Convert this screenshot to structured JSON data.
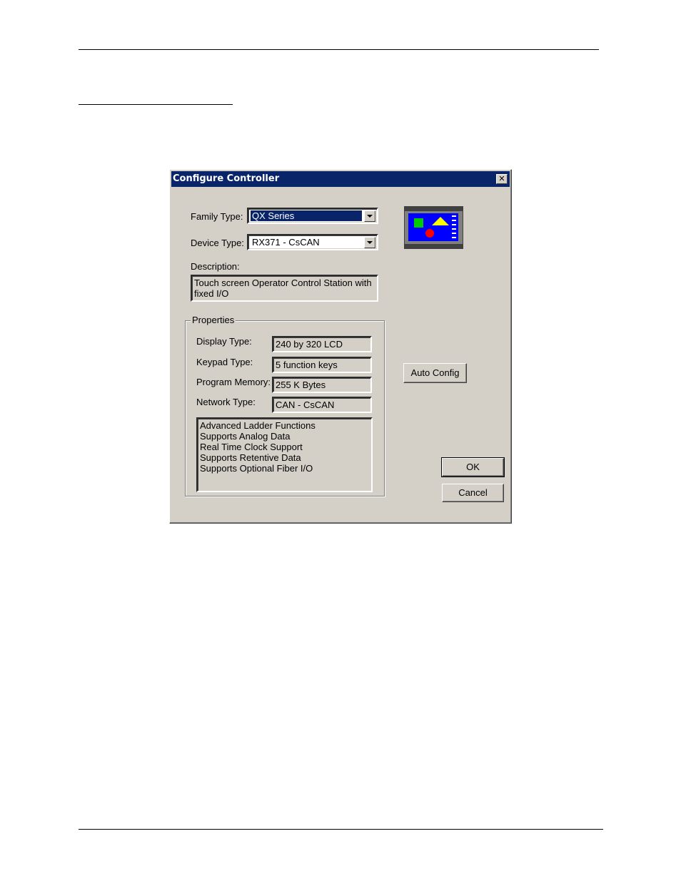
{
  "dialog": {
    "title": "Configure Controller",
    "close_label": "✕",
    "family_type": {
      "label": "Family Type:",
      "value": "QX Series"
    },
    "device_type": {
      "label": "Device Type:",
      "value": "RX371 - CsCAN"
    },
    "description": {
      "label": "Description:",
      "lines": [
        "Touch screen Operator Control Station with",
        "fixed I/O"
      ]
    },
    "properties": {
      "title": "Properties",
      "display_type": {
        "label": "Display Type:",
        "value": "240 by 320 LCD"
      },
      "keypad_type": {
        "label": "Keypad Type:",
        "value": "5 function keys"
      },
      "program_memory": {
        "label": "Program Memory:",
        "value": "255 K Bytes"
      },
      "network_type": {
        "label": "Network Type:",
        "value": "CAN - CsCAN"
      },
      "features": [
        "Advanced Ladder Functions",
        "Supports Analog Data",
        "Real Time Clock Support",
        "Supports Retentive Data",
        "Supports Optional Fiber I/O"
      ]
    },
    "buttons": {
      "auto_config": "Auto Config",
      "ok": "OK",
      "cancel": "Cancel"
    },
    "colors": {
      "title_bar": "#0a246a",
      "dialog_bg": "#d4d0c8",
      "device_screen": "#0000ff"
    }
  }
}
